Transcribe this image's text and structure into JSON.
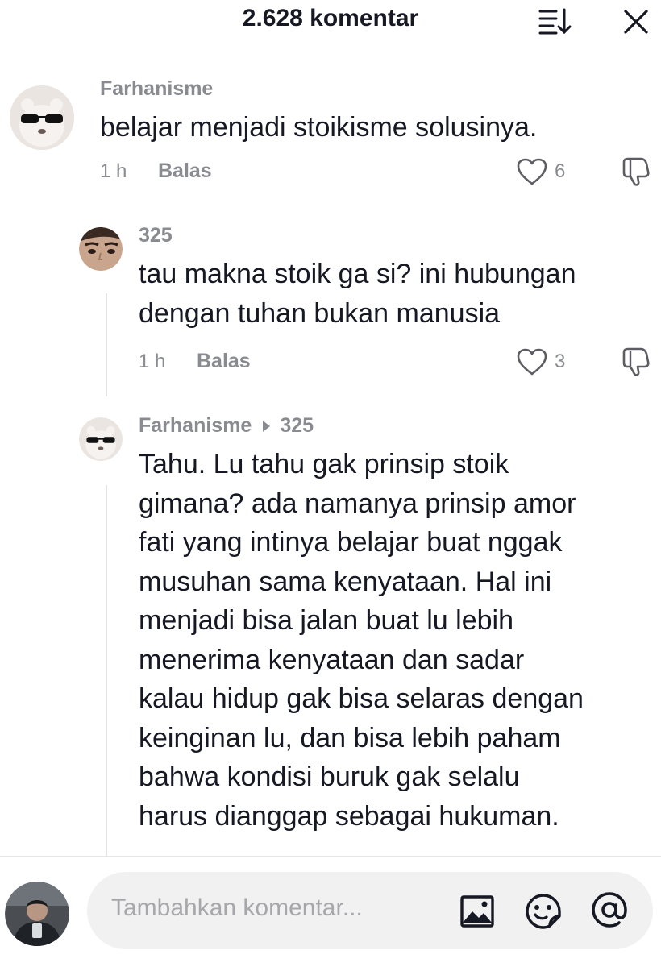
{
  "header": {
    "title": "2.628 komentar",
    "sort_icon": "sort-icon",
    "close_icon": "close-icon"
  },
  "comments": [
    {
      "username": "Farhanisme",
      "text": "belajar menjadi stoikisme solusinya.",
      "time": "1 h",
      "reply_label": "Balas",
      "likes": "6",
      "avatar_icon": "bear-sunglasses-avatar"
    },
    {
      "username": "325",
      "text_lines": [
        "tau makna stoik ga si? ini hubungan",
        "dengan tuhan bukan manusia"
      ],
      "time": "1 h",
      "reply_label": "Balas",
      "likes": "3",
      "avatar_icon": "face-avatar"
    },
    {
      "username": "Farhanisme",
      "reply_to": "325",
      "text_lines": [
        "Tahu. Lu tahu gak prinsip stoik",
        "gimana? ada namanya prinsip amor",
        "fati yang intinya belajar buat nggak",
        "musuhan sama kenyataan. Hal ini",
        "menjadi bisa jalan buat lu lebih",
        "menerima kenyataan dan sadar",
        "kalau hidup gak bisa selaras dengan",
        "keinginan lu, dan bisa lebih paham",
        "bahwa kondisi buruk gak selalu",
        "harus dianggap sebagai hukuman."
      ],
      "avatar_icon": "bear-sunglasses-avatar"
    }
  ],
  "composer": {
    "placeholder": "Tambahkan komentar...",
    "icons": [
      "image-icon",
      "emoji-icon",
      "mention-icon"
    ]
  },
  "colors": {
    "text": "#161823",
    "muted": "#8a8b91",
    "input_bg": "#f1f1f2",
    "thread_line": "#e3e3e4"
  }
}
